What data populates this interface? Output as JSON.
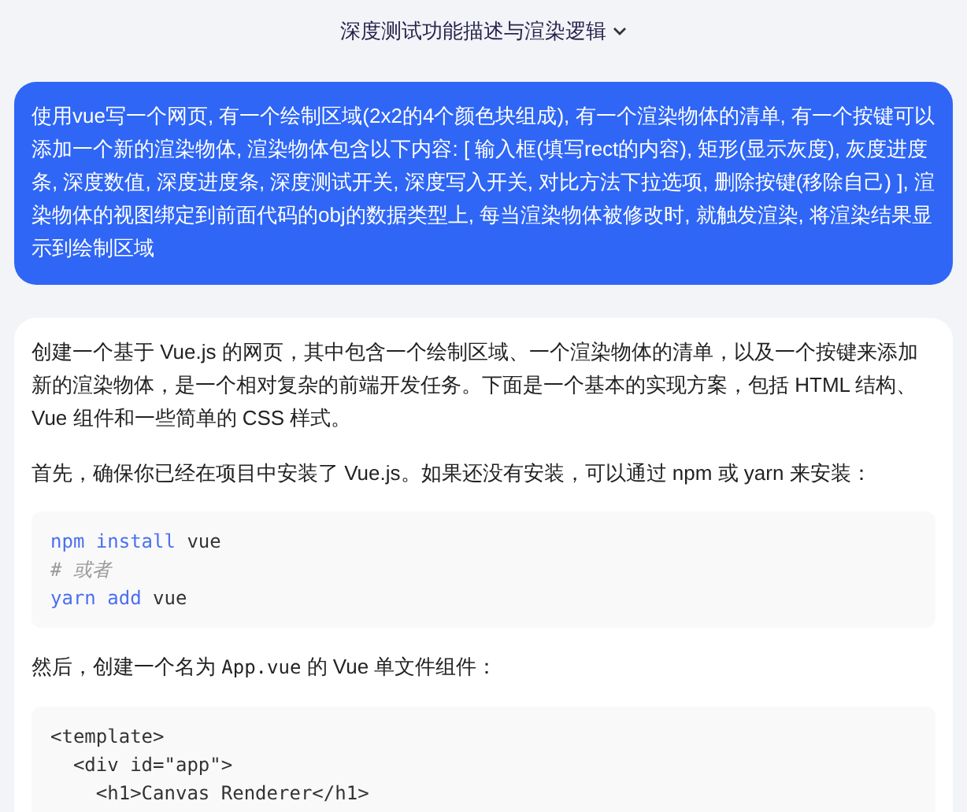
{
  "header": {
    "title": "深度测试功能描述与渲染逻辑"
  },
  "user_message": "使用vue写一个网页, 有一个绘制区域(2x2的4个颜色块组成), 有一个渲染物体的清单, 有一个按键可以添加一个新的渲染物体, 渲染物体包含以下内容: [ 输入框(填写rect的内容), 矩形(显示灰度), 灰度进度条, 深度数值, 深度进度条, 深度测试开关, 深度写入开关, 对比方法下拉选项, 删除按键(移除自己) ], 渲染物体的视图绑定到前面代码的obj的数据类型上, 每当渲染物体被修改时, 就触发渲染, 将渲染结果显示到绘制区域",
  "answer": [
    {
      "kind": "paragraph",
      "parts": [
        {
          "kind": "text",
          "text": "创建一个基于 Vue.js 的网页，其中包含一个绘制区域、一个渲染物体的清单，以及一个按键来添加新的渲染物体，是一个相对复杂的前端开发任务。下面是一个基本的实现方案，包括 HTML 结构、Vue 组件和一些简单的 CSS 样式。"
        }
      ]
    },
    {
      "kind": "paragraph",
      "parts": [
        {
          "kind": "text",
          "text": "首先，确保你已经在项目中安装了 Vue.js。如果还没有安装，可以通过 npm 或 yarn 来安装："
        }
      ]
    },
    {
      "kind": "code",
      "lines": [
        [
          {
            "kind": "keyword",
            "text": "npm install"
          },
          {
            "kind": "plain",
            "text": " vue"
          }
        ],
        [
          {
            "kind": "comment",
            "text": "# 或者"
          }
        ],
        [
          {
            "kind": "keyword",
            "text": "yarn add"
          },
          {
            "kind": "plain",
            "text": " vue"
          }
        ]
      ]
    },
    {
      "kind": "paragraph",
      "parts": [
        {
          "kind": "text",
          "text": "然后，创建一个名为 "
        },
        {
          "kind": "code",
          "text": "App.vue"
        },
        {
          "kind": "text",
          "text": " 的 Vue 单文件组件："
        }
      ]
    },
    {
      "kind": "code",
      "lines": [
        [
          {
            "kind": "plain",
            "text": "<template>"
          }
        ],
        [
          {
            "kind": "plain",
            "text": "  <div id=\"app\">"
          }
        ],
        [
          {
            "kind": "plain",
            "text": "    <h1>Canvas Renderer</h1>"
          }
        ]
      ]
    }
  ]
}
